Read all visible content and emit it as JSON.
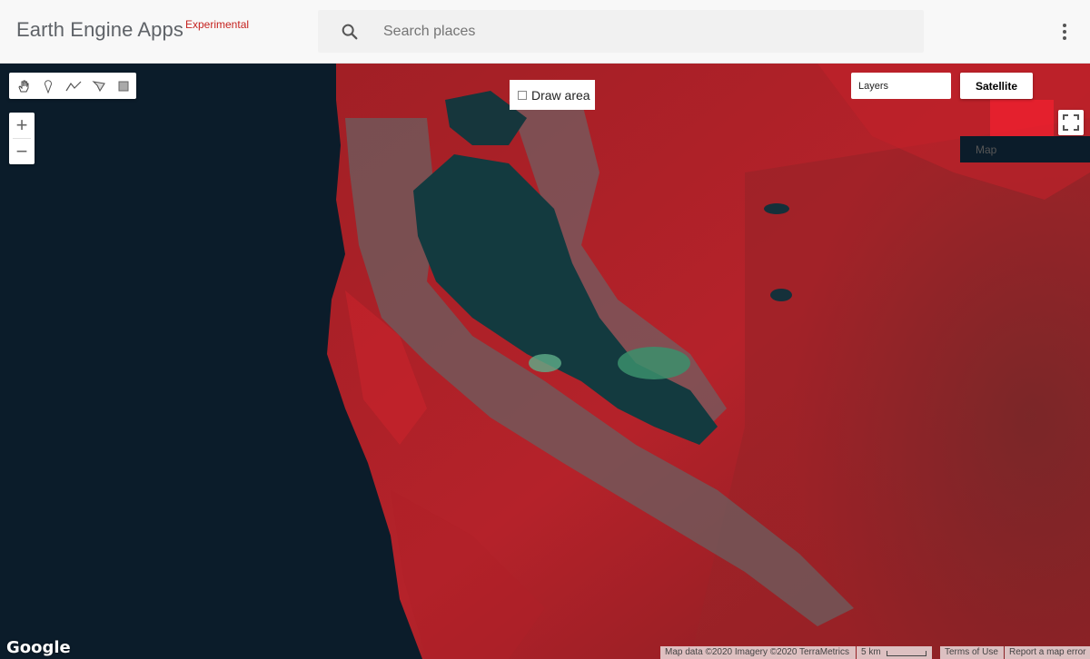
{
  "header": {
    "brand": "Earth Engine Apps",
    "badge": "Experimental",
    "search_placeholder": "Search places",
    "search_icon": "search-icon",
    "more_icon": "more-vert-icon"
  },
  "map": {
    "draw_tools": [
      "hand-icon",
      "marker-icon",
      "line-icon",
      "polygon-icon",
      "rectangle-icon"
    ],
    "zoom_in": "+",
    "zoom_out": "−",
    "draw_area_label": "Draw area",
    "layers_label": "Layers",
    "map_type": {
      "map": "Map",
      "satellite": "Satellite",
      "selected": "Satellite"
    },
    "google_logo": "Google",
    "attribution": {
      "data": "Map data ©2020 Imagery ©2020 TerraMetrics",
      "scale": "5 km",
      "terms": "Terms of Use",
      "report": "Report a map error"
    }
  },
  "colors": {
    "ocean": "#0b1c2a",
    "land": "#8c1f22",
    "vegetation": "#d4232b",
    "bay": "#133a3f",
    "urban": "#6d6a6a",
    "badge": "#c5221f"
  }
}
